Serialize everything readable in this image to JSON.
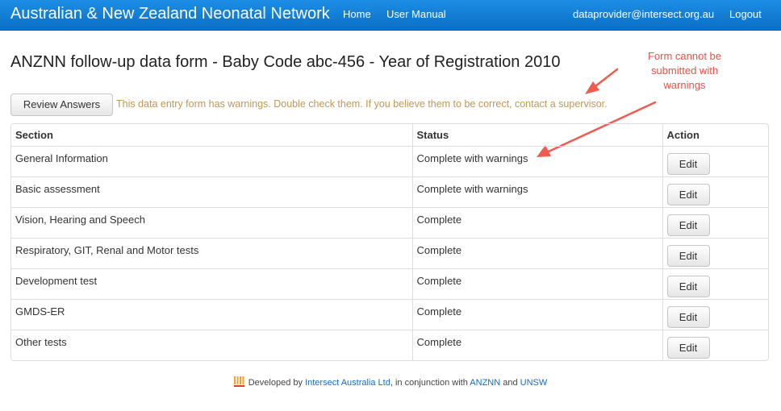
{
  "header": {
    "brand": "Australian & New Zealand Neonatal Network",
    "nav": {
      "home": "Home",
      "manual": "User Manual",
      "user": "dataprovider@intersect.org.au",
      "logout": "Logout"
    }
  },
  "page": {
    "title": "ANZNN follow-up data form - Baby Code abc-456 - Year of Registration 2010",
    "review_button": "Review Answers",
    "warning": "This data entry form has warnings. Double check them. If you believe them to be correct, contact a supervisor.",
    "annotation": "Form cannot be submitted with warnings"
  },
  "table": {
    "headers": {
      "section": "Section",
      "status": "Status",
      "action": "Action"
    },
    "rows": [
      {
        "section": "General Information",
        "status": "Complete with warnings",
        "action": "Edit"
      },
      {
        "section": "Basic assessment",
        "status": "Complete with warnings",
        "action": "Edit"
      },
      {
        "section": "Vision, Hearing and Speech",
        "status": "Complete",
        "action": "Edit"
      },
      {
        "section": "Respiratory, GIT, Renal and Motor tests",
        "status": "Complete",
        "action": "Edit"
      },
      {
        "section": "Development test",
        "status": "Complete",
        "action": "Edit"
      },
      {
        "section": "GMDS-ER",
        "status": "Complete",
        "action": "Edit"
      },
      {
        "section": "Other tests",
        "status": "Complete",
        "action": "Edit"
      }
    ]
  },
  "footer": {
    "prefix": "Developed by",
    "intersect": "Intersect Australia Ltd",
    "middle": ", in conjunction with",
    "anznn": "ANZNN",
    "and": "and",
    "unsw": "UNSW"
  },
  "colors": {
    "navbar": "#0b6fc6",
    "warning": "#c09853",
    "annotation": "#e9514b",
    "link": "#1769c2"
  }
}
